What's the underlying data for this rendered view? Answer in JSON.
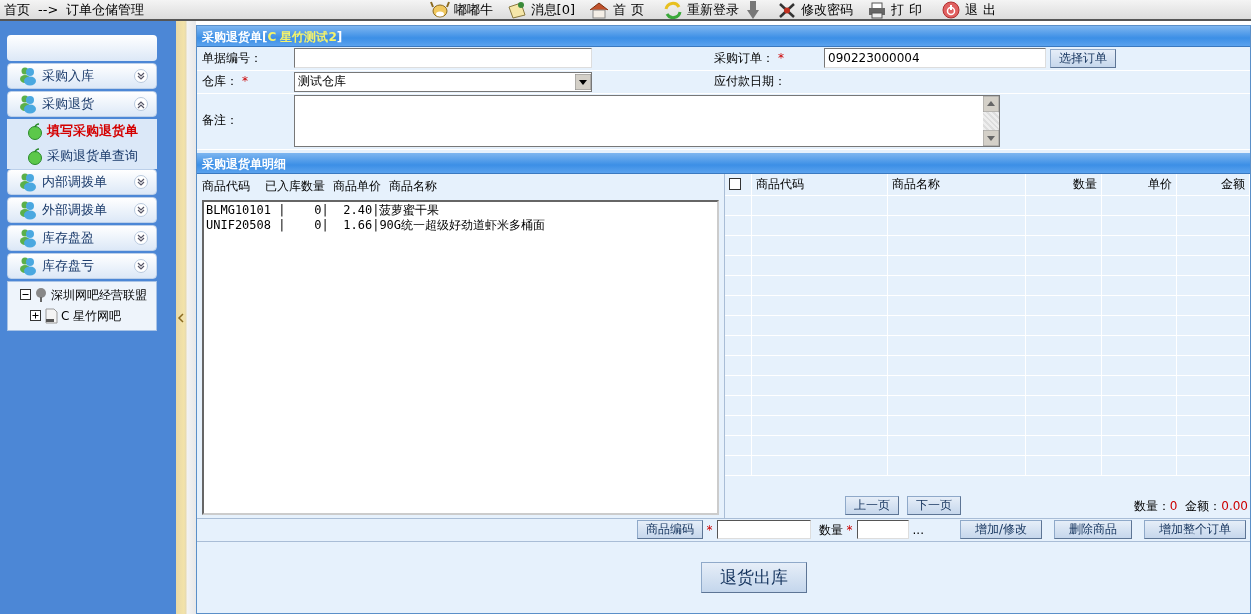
{
  "breadcrumb": {
    "home": "首页",
    "separator": "-->",
    "current": "订单仓储管理"
  },
  "toolbar": [
    {
      "label": "嘟嘟牛",
      "kind": "user"
    },
    {
      "label": "消息[0]",
      "kind": "message"
    },
    {
      "label": "首页",
      "kind": "home"
    },
    {
      "label": "重新登录",
      "kind": "relogin"
    },
    {
      "label": "修改密码",
      "kind": "password"
    },
    {
      "label": "打印",
      "kind": "print"
    },
    {
      "label": "退出",
      "kind": "exit"
    }
  ],
  "sidebar": {
    "groups": [
      {
        "label": "采购入库",
        "expanded": false
      },
      {
        "label": "采购退货",
        "expanded": true,
        "items": [
          {
            "label": "填写采购退货单",
            "selected": true
          },
          {
            "label": "采购退货单查询",
            "selected": false
          }
        ]
      },
      {
        "label": "内部调拨单",
        "expanded": false
      },
      {
        "label": "外部调拨单",
        "expanded": false
      },
      {
        "label": "库存盘盈",
        "expanded": false
      },
      {
        "label": "库存盘亏",
        "expanded": false
      }
    ],
    "tree": [
      {
        "label": "深圳网吧经营联盟",
        "expanded": true,
        "children": [
          {
            "label": "C 星竹网吧",
            "expanded": false
          }
        ]
      }
    ]
  },
  "order": {
    "title_prefix": "采购退货单[",
    "title_name": "C 星竹测试2",
    "title_suffix": "]",
    "fields": [
      {
        "label": "单据编号：",
        "kind": "input"
      },
      {
        "label": "采购订单：",
        "mark": "*",
        "kind": "input",
        "value": "090223000004",
        "button": "选择订单"
      },
      {
        "label": "仓库：",
        "mark": "*",
        "kind": "select",
        "value": "测试仓库"
      },
      {
        "label": "应付款日期：",
        "kind": "text"
      },
      {
        "label": "备注：",
        "kind": "textarea"
      }
    ]
  },
  "details": {
    "title": "采购退货单明细",
    "list_header": "商品代码    已入库数量  商品单价  商品名称",
    "list_rows": [
      "BLMG10101 |    0|  2.40|菠萝蜜干果",
      "UNIF20508 |    0|  1.66|90G统一超级好劲道虾米多桶面"
    ],
    "table": {
      "select_all": false,
      "columns": [
        "商品代码",
        "商品名称",
        "数量",
        "单价",
        "金额"
      ]
    },
    "pager": [
      "上一页",
      "下一页"
    ],
    "totals": [
      {
        "label": "数量：",
        "value": "0"
      },
      {
        "label": "金额：",
        "value": "0.00"
      }
    ],
    "entry": {
      "code_button": "商品编码",
      "code_mark": "*",
      "qty_label": "数量",
      "qty_mark": "*",
      "more": "...",
      "buttons": [
        "增加/修改",
        "删除商品",
        "增加整个订单"
      ]
    }
  },
  "submit": "退货出库"
}
